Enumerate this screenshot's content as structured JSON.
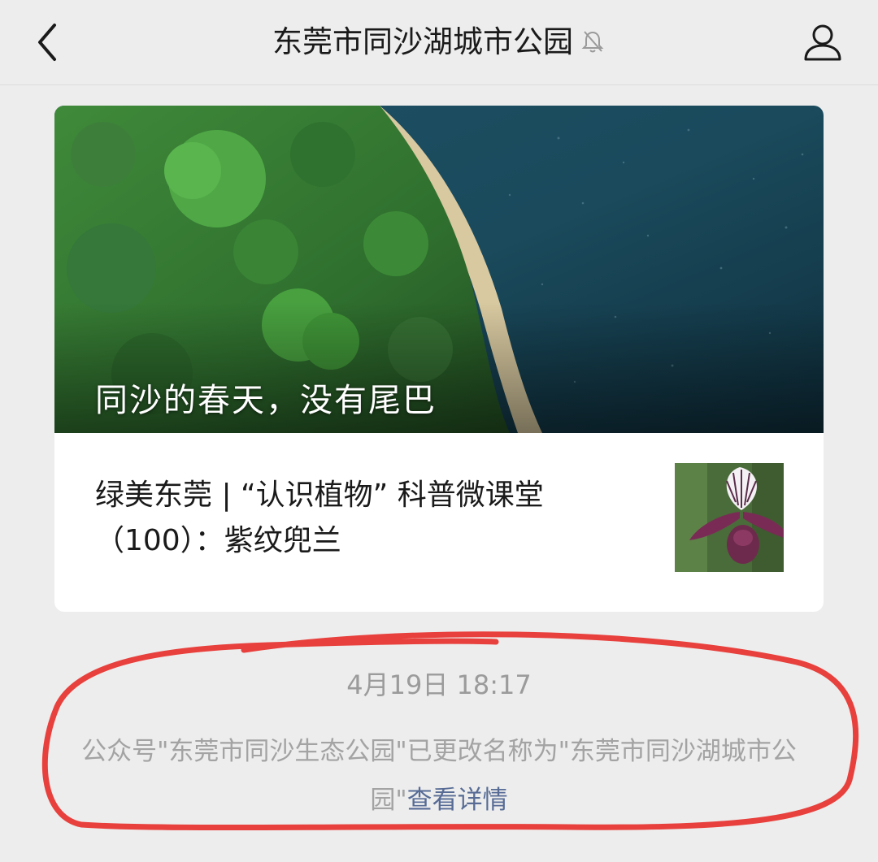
{
  "header": {
    "back_icon": "chevron-left-icon",
    "title": "东莞市同沙湖城市公园",
    "mute_icon": "bell-muted-icon",
    "profile_icon": "person-icon"
  },
  "article": {
    "cover_title": "同沙的春天，没有尾巴",
    "secondary_title": "绿美东莞 | “认识植物” 科普微课堂（100）：紫纹兜兰"
  },
  "system_message": {
    "timestamp": "4月19日 18:17",
    "notice_text": "公众号\"东莞市同沙生态公园\"已更改名称为\"东莞市同沙湖城市公园\"",
    "link_text": "查看详情"
  },
  "colors": {
    "background": "#ededed",
    "link": "#576b95",
    "annotation_red": "#e8403c"
  }
}
